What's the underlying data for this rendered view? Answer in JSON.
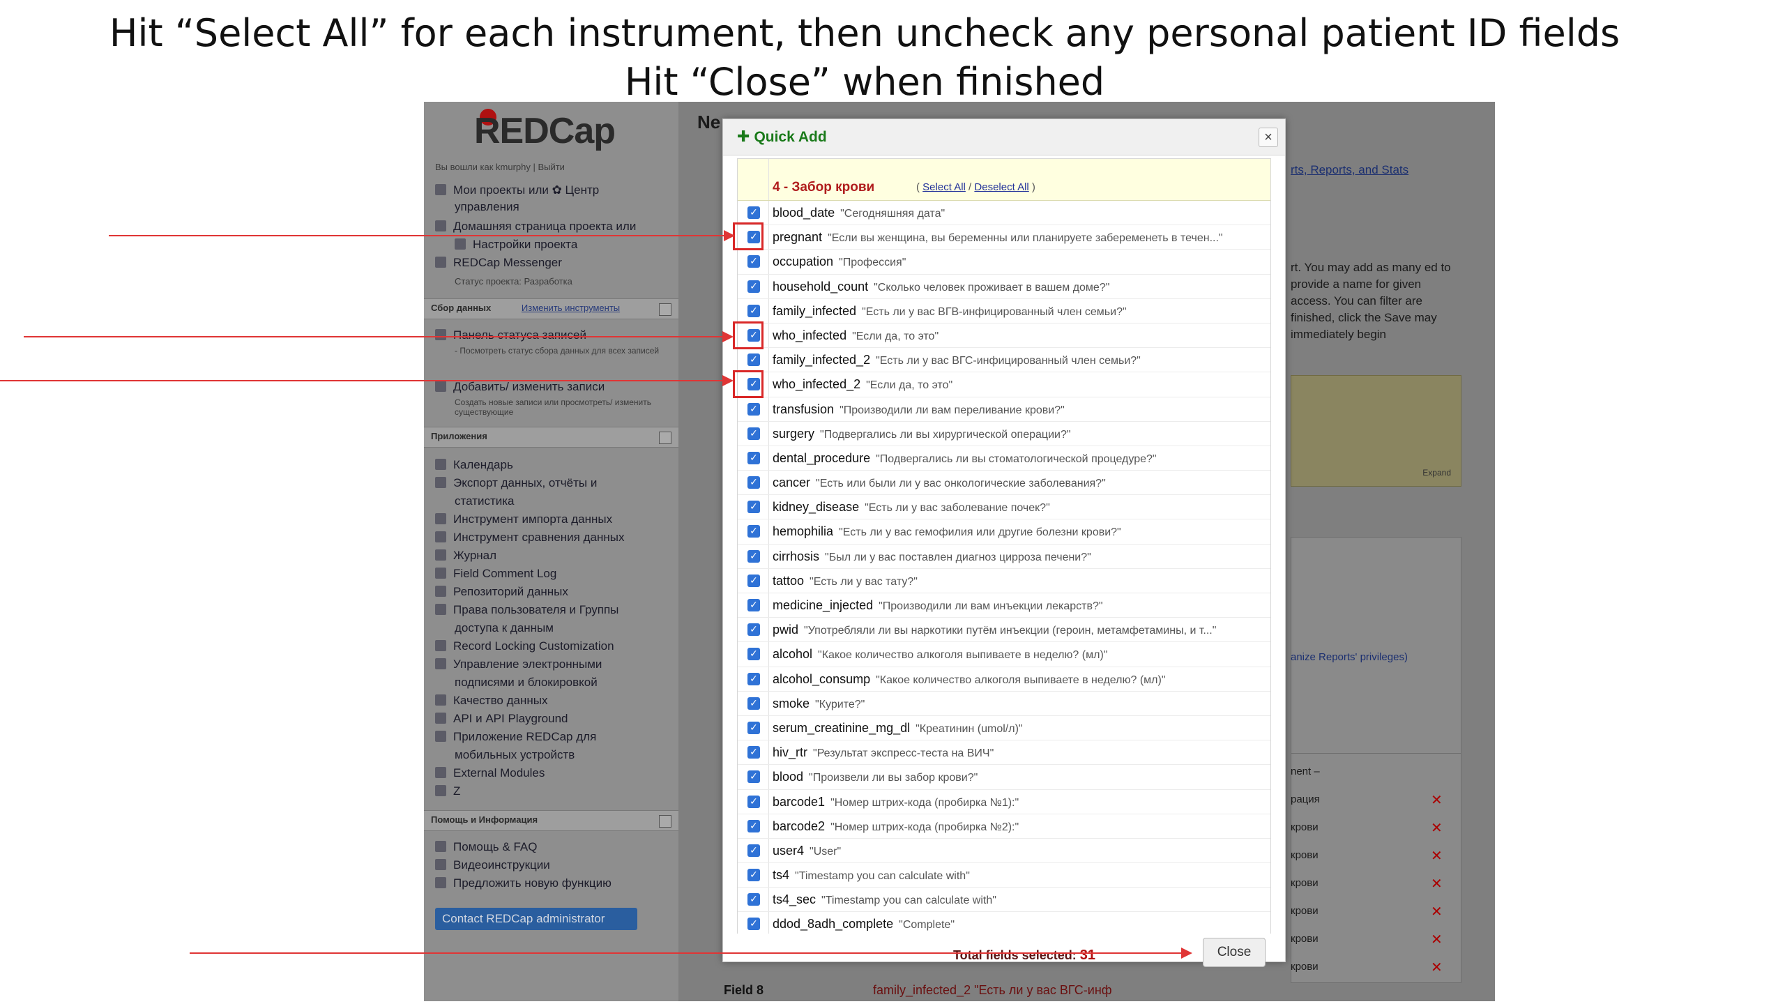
{
  "slide": {
    "title_line1": "Hit “Select All” for each instrument, then uncheck any personal patient ID fields",
    "title_line2": "Hit “Close” when finished"
  },
  "sidebar": {
    "logo": "REDCap",
    "logged_in": "Вы вошли как kmurphy | Выйти",
    "items": [
      "Мои проекты или ✿ Центр",
      "управления",
      "Домашняя страница проекта или",
      "Настройки проекта",
      "REDCap Messenger"
    ],
    "project_status": "Статус проекта: Разработка",
    "section_collect": "Сбор данных",
    "edit_instruments": "Изменить инструменты",
    "record_status": "Панель статуса записей",
    "record_status_sub": "- Посмотреть статус сбора данных для всех записей",
    "add_edit": "Добавить/ изменить записи",
    "add_edit_sub": "Создать новые записи или просмотреть/ изменить существующие",
    "section_apps": "Приложения",
    "apps": [
      "Календарь",
      "Экспорт данных, отчёты и",
      "статистика",
      "Инструмент импорта данных",
      "Инструмент сравнения данных",
      "Журнал",
      "Field Comment Log",
      "Репозиторий данных",
      "Права пользователя и Группы",
      "доступа к данным",
      "Record Locking Customization",
      "Управление электронными",
      "подписями и блокировкой",
      "Качество данных",
      "API и API Playground",
      "Приложение REDCap для",
      "мобильных устройств",
      "External Modules",
      "Z"
    ],
    "section_help": "Помощь и Информация",
    "help": [
      "Помощь & FAQ",
      "Видеоинструкции",
      "Предложить новую функцию"
    ],
    "contact_button": "Contact REDCap administrator"
  },
  "background": {
    "title": "Ne",
    "link": "rts, Reports, and Stats",
    "paragraph": "rt. You may add as many ed to provide a name for given access. You can filter are finished, click the Save may immediately begin",
    "expand": "Expand",
    "privileges": "anize Reports' privileges)",
    "list_items": [
      "nent –",
      "рация",
      "крови",
      "крови",
      "крови",
      "крови",
      "крови",
      "крови"
    ],
    "field8_label": "Field 8",
    "field8_value": "family_infected_2 \"Есть ли у вас ВГС-инф"
  },
  "modal": {
    "title": "Quick Add",
    "instrument": "4 - Забор крови",
    "select_all": "Select All",
    "deselect_all": "Deselect All",
    "fields": [
      {
        "var": "blood_date",
        "label": "\"Сегодняшняя дата\""
      },
      {
        "var": "pregnant",
        "label": "\"Если вы женщина, вы беременны или планируете забеременеть в течен...\""
      },
      {
        "var": "occupation",
        "label": "\"Профессия\""
      },
      {
        "var": "household_count",
        "label": "\"Сколько человек проживает в вашем доме?\""
      },
      {
        "var": "family_infected",
        "label": "\"Есть ли у вас ВГВ-инфицированный член семьи?\""
      },
      {
        "var": "who_infected",
        "label": "\"Если да, то это\""
      },
      {
        "var": "family_infected_2",
        "label": "\"Есть ли у вас ВГС-инфицированный член семьи?\""
      },
      {
        "var": "who_infected_2",
        "label": "\"Если да, то это\""
      },
      {
        "var": "transfusion",
        "label": "\"Производили ли вам переливание крови?\""
      },
      {
        "var": "surgery",
        "label": "\"Подвергались ли вы хирургической операции?\""
      },
      {
        "var": "dental_procedure",
        "label": "\"Подвергались ли вы стоматологической процедуре?\""
      },
      {
        "var": "cancer",
        "label": "\"Есть или были ли у вас онкологические заболевания?\""
      },
      {
        "var": "kidney_disease",
        "label": "\"Есть ли у вас заболевание почек?\""
      },
      {
        "var": "hemophilia",
        "label": "\"Есть ли у вас гемофилия или другие болезни крови?\""
      },
      {
        "var": "cirrhosis",
        "label": "\"Был ли у вас поставлен диагноз цирроза печени?\""
      },
      {
        "var": "tattoo",
        "label": "\"Есть ли у вас тату?\""
      },
      {
        "var": "medicine_injected",
        "label": "\"Производили ли вам инъекции лекарств?\""
      },
      {
        "var": "pwid",
        "label": "\"Употребляли ли вы наркотики путём инъекции (героин, метамфетамины, и т...\""
      },
      {
        "var": "alcohol",
        "label": "\"Какое количество алкоголя выпиваете в неделю? (мл)\""
      },
      {
        "var": "alcohol_consump",
        "label": "\"Какое количество алкоголя выпиваете в неделю? (мл)\""
      },
      {
        "var": "smoke",
        "label": "\"Курите?\""
      },
      {
        "var": "serum_creatinine_mg_dl",
        "label": "\"Креатинин (umol/л)\""
      },
      {
        "var": "hiv_rtr",
        "label": "\"Результат экспресс-теста на ВИЧ\""
      },
      {
        "var": "blood",
        "label": "\"Произвели ли вы забор крови?\""
      },
      {
        "var": "barcode1",
        "label": "\"Номер штрих-кода (пробирка №1):\""
      },
      {
        "var": "barcode2",
        "label": "\"Номер штрих-кода (пробирка №2):\""
      },
      {
        "var": "user4",
        "label": "\"User\""
      },
      {
        "var": "ts4",
        "label": "\"Timestamp you can calculate with\""
      },
      {
        "var": "ts4_sec",
        "label": "\"Timestamp you can calculate with\""
      },
      {
        "var": "ddod_8adh_complete",
        "label": "\"Complete\""
      }
    ],
    "total_label": "Total fields selected:",
    "total_value": "31",
    "close_button": "Close"
  }
}
